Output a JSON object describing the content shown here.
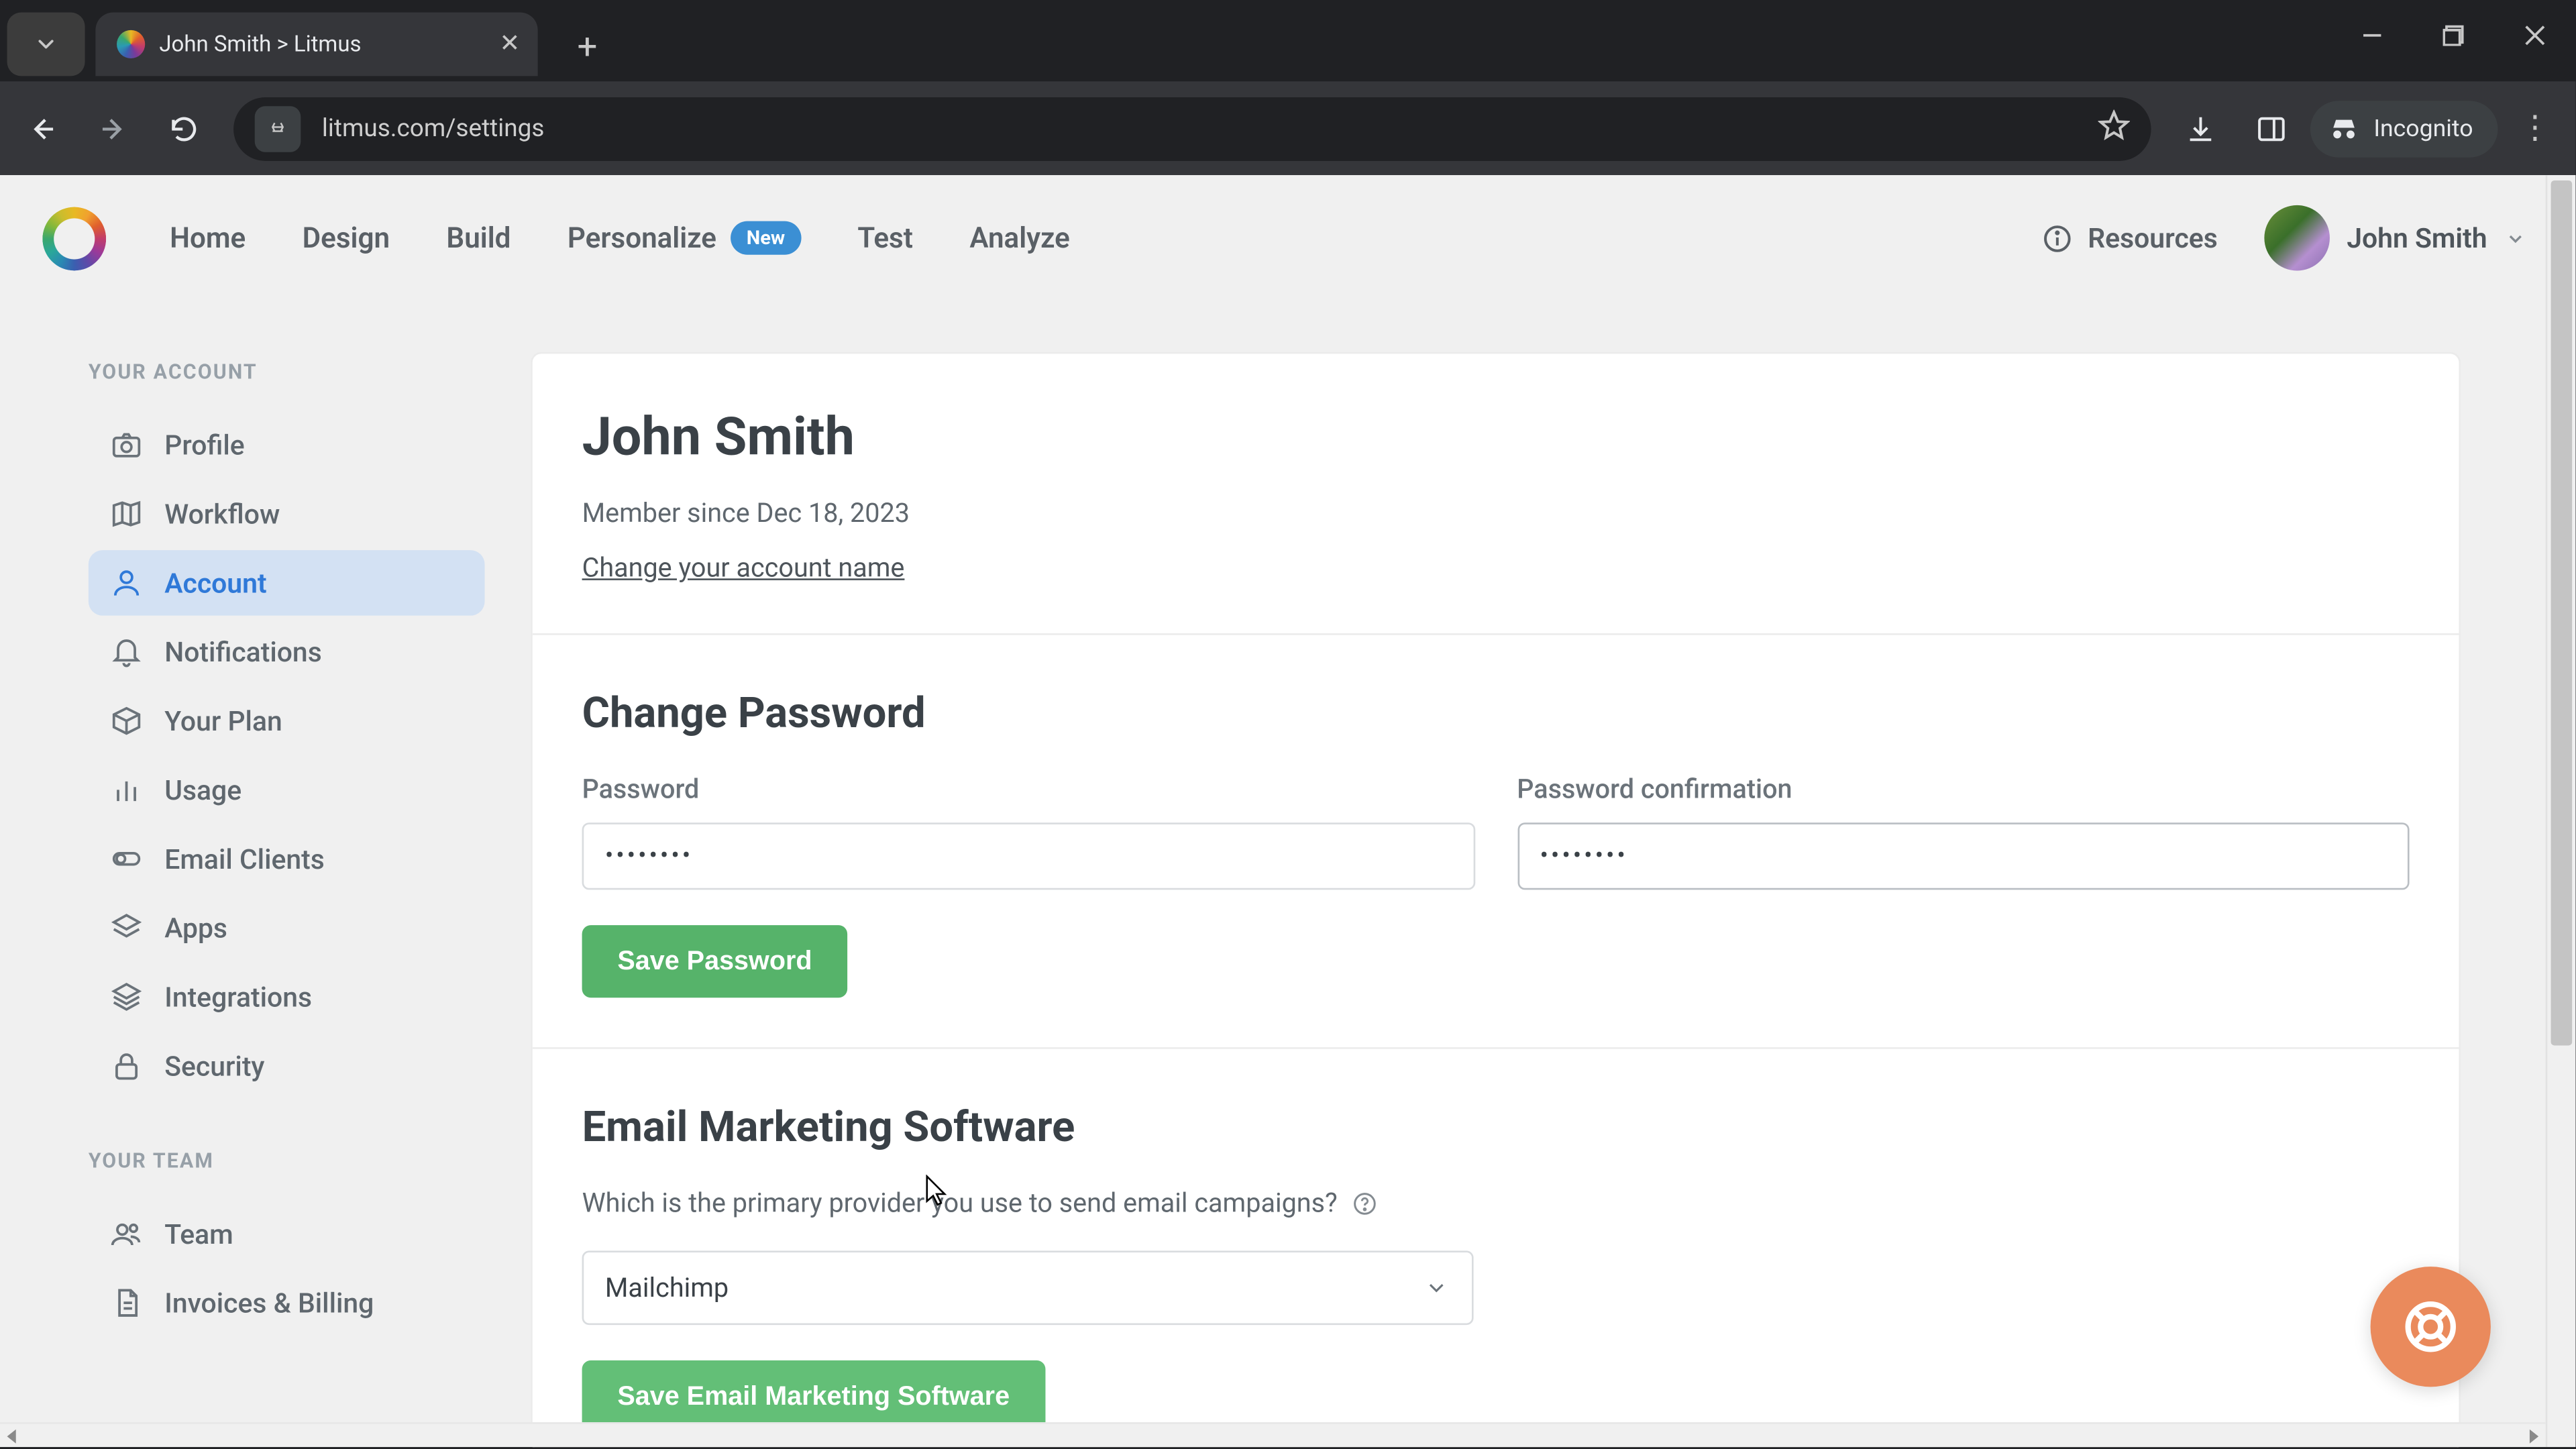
{
  "browser": {
    "tab_title": "John Smith > Litmus",
    "url_host": "litmus.com",
    "url_path": "/settings",
    "incognito_label": "Incognito"
  },
  "topnav": {
    "links": {
      "home": "Home",
      "design": "Design",
      "build": "Build",
      "personalize": "Personalize",
      "personalize_badge": "New",
      "test": "Test",
      "analyze": "Analyze"
    },
    "resources": "Resources",
    "user_name": "John Smith"
  },
  "sidebar": {
    "heading_account": "YOUR ACCOUNT",
    "heading_team": "YOUR TEAM",
    "items": {
      "profile": "Profile",
      "workflow": "Workflow",
      "account": "Account",
      "notifications": "Notifications",
      "your_plan": "Your Plan",
      "usage": "Usage",
      "email_clients": "Email Clients",
      "apps": "Apps",
      "integrations": "Integrations",
      "security": "Security",
      "team": "Team",
      "invoices": "Invoices & Billing"
    }
  },
  "main": {
    "title": "John Smith",
    "member_since": "Member since Dec 18, 2023",
    "change_name_link": "Change your account name",
    "password_heading": "Change Password",
    "password_label": "Password",
    "password_confirmation_label": "Password confirmation",
    "password_value": "••••••••",
    "password_confirmation_value": "••••••••",
    "save_password_btn": "Save Password",
    "ems_heading": "Email Marketing Software",
    "ems_question": "Which is the primary provider you use to send email campaigns?",
    "ems_selected": "Mailchimp",
    "save_ems_btn": "Save Email Marketing Software"
  },
  "colors": {
    "accent_blue": "#2f79d8",
    "green_btn": "#56b36a",
    "fab_orange": "#ea8a5c"
  }
}
